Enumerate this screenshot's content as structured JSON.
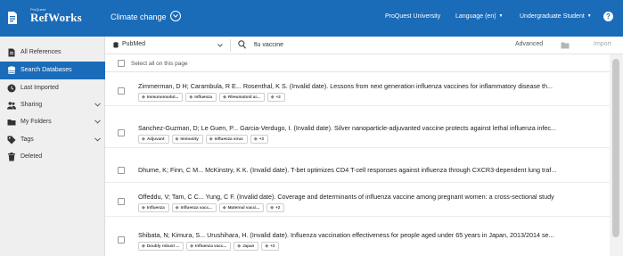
{
  "header": {
    "brand_small": "ProQuest·",
    "brand": "RefWorks",
    "project": "Climate change",
    "institution": "ProQuest University",
    "language": "Language (en)",
    "user_role": "Undergraduate Student",
    "help": "?"
  },
  "sidebar": {
    "items": [
      {
        "label": "All References",
        "icon": "document-icon"
      },
      {
        "label": "Search Databases",
        "icon": "database-icon",
        "active": true
      },
      {
        "label": "Last Imported",
        "icon": "clock-icon"
      },
      {
        "label": "Sharing",
        "icon": "people-icon"
      },
      {
        "label": "My Folders",
        "icon": "folder-icon"
      },
      {
        "label": "Tags",
        "icon": "tag-icon"
      },
      {
        "label": "Deleted",
        "icon": "trash-icon"
      }
    ]
  },
  "search": {
    "database": "PubMed",
    "query": "flu vaccine",
    "advanced": "Advanced",
    "import": "Import"
  },
  "results": {
    "select_all": "Select all on this page",
    "items": [
      {
        "citation": "Zimmerman, D H; Carambula, R E... Rosenthal, K S. (Invalid date). Lessons from next generation influenza vaccines for inflammatory disease th...",
        "tags": [
          "Immunomodul...",
          "Influenza",
          "Rheumatoid ar...",
          "+2"
        ]
      },
      {
        "citation": "Sanchez-Guzman, D; Le Guen, P... Garcia-Verdugo, I. (Invalid date). Silver nanoparticle-adjuvanted vaccine protects against lethal influenza infec...",
        "tags": [
          "Adjuvant",
          "Immunity",
          "Influenza virus",
          "+3"
        ]
      },
      {
        "citation": "Dhume, K; Finn, C M... McKinstry, K K. (Invalid date). T-bet optimizes CD4 T-cell responses against influenza through CXCR3-dependent lung traf...",
        "tags": []
      },
      {
        "citation": "Offeddu, V; Tam, C C... Yung, C F. (Invalid date). Coverage and determinants of influenza vaccine among pregnant women: a cross-sectional study",
        "tags": [
          "Influenza",
          "Influenza vacc...",
          "Maternal vacci...",
          "+2"
        ]
      },
      {
        "citation": "Shibata, N; Kimura, S... Urushihara, H. (Invalid date). Influenza vaccination effectiveness for people aged under 65 years in Japan, 2013/2014 se...",
        "tags": [
          "Doubly robust ...",
          "Influenza vacc...",
          "Japan",
          "+2"
        ]
      }
    ]
  },
  "colors": {
    "brand_blue": "#1a6bb8",
    "sidebar_bg": "#efefef"
  }
}
